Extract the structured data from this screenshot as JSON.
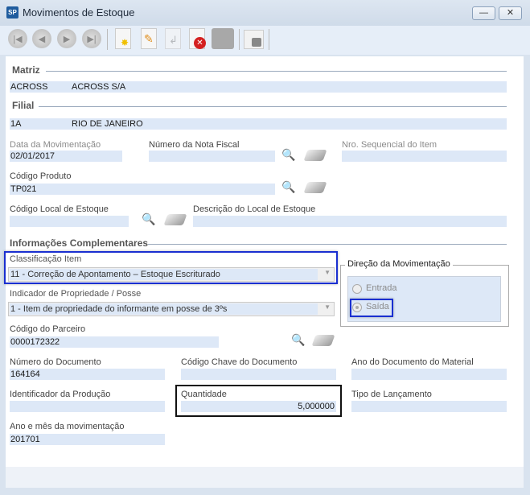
{
  "window": {
    "title": "Movimentos de Estoque",
    "logo": "SP",
    "minimize": "—",
    "close": "✕"
  },
  "toolbar": {
    "icons": [
      "first-record",
      "previous-record",
      "next-record",
      "last-record",
      "new-document",
      "edit-document",
      "undo",
      "delete",
      "save",
      "lock"
    ]
  },
  "matriz": {
    "label": "Matriz",
    "code": "ACROSS",
    "name": "ACROSS S/A"
  },
  "filial": {
    "label": "Filial",
    "code": "1A",
    "name": "RIO DE JANEIRO"
  },
  "fields": {
    "data_mov": {
      "label": "Data da Movimentação",
      "value": "02/01/2017"
    },
    "nota_fiscal": {
      "label": "Número da Nota Fiscal",
      "value": ""
    },
    "nro_seq": {
      "label": "Nro. Sequencial do Item",
      "value": ""
    },
    "codigo_produto": {
      "label": "Código Produto",
      "value": "TP021"
    },
    "codigo_local": {
      "label": "Código Local de Estoque",
      "value": ""
    },
    "descricao_local": {
      "label": "Descrição do Local de Estoque",
      "value": ""
    },
    "classificacao": {
      "label": "Classificação Item",
      "value": "11 - Correção de Apontamento – Estoque Escriturado"
    },
    "indicador": {
      "label": "Indicador de Propriedade / Posse",
      "value": "1 - Item de propriedade do informante em posse de 3ºs"
    },
    "codigo_parceiro": {
      "label": "Código do Parceiro",
      "value": "0000172322"
    },
    "numero_doc": {
      "label": "Número do Documento",
      "value": "164164"
    },
    "chave_doc": {
      "label": "Código Chave do Documento",
      "value": ""
    },
    "ano_doc": {
      "label": "Ano do Documento do Material",
      "value": ""
    },
    "ident_producao": {
      "label": "Identificador da Produção",
      "value": ""
    },
    "quantidade": {
      "label": "Quantidade",
      "value": "5,000000"
    },
    "tipo_lanc": {
      "label": "Tipo de Lançamento",
      "value": ""
    },
    "ano_mes": {
      "label": "Ano e mês da movimentação",
      "value": "201701"
    }
  },
  "info_section": "Informações Complementares",
  "direcao": {
    "label": "Direção da Movimentação",
    "options": [
      "Entrada",
      "Saída"
    ],
    "selected": "Saída"
  }
}
